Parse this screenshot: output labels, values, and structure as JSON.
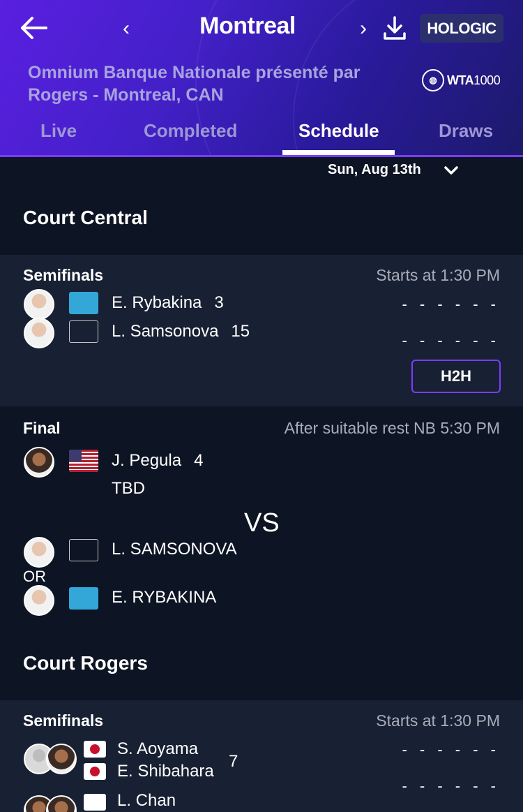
{
  "header": {
    "title": "Montreal",
    "sponsor": "HOLOGIC",
    "tournament_name": "Omnium Banque Nationale présenté par Rogers  - Montreal, CAN",
    "wta_label": "WTA",
    "wta_level": "1000",
    "tabs": [
      {
        "label": "Live"
      },
      {
        "label": "Completed"
      },
      {
        "label": "Schedule"
      },
      {
        "label": "Draws"
      }
    ],
    "active_tab": "Schedule",
    "accent_color": "#7b3cff"
  },
  "date_selector": {
    "value": "Sun, Aug 13th"
  },
  "courts": [
    {
      "name": "Court Central",
      "matches": [
        {
          "round": "Semifinals",
          "start": "Starts at 1:30 PM",
          "players": [
            {
              "name": "E. Rybakina",
              "seed": "3",
              "flag": "KAZ",
              "score": "- - - - - -"
            },
            {
              "name": "L. Samsonova",
              "seed": "15",
              "flag": "blank",
              "score": "- - - - - -"
            }
          ],
          "h2h_label": "H2H"
        },
        {
          "round": "Final",
          "start": "After suitable rest NB 5:30 PM",
          "player1": {
            "name": "J. Pegula",
            "seed": "4",
            "flag": "USA"
          },
          "tbd": "TBD",
          "vs": "VS",
          "or": "OR",
          "options": [
            {
              "name": "L. SAMSONOVA",
              "flag": "blank"
            },
            {
              "name": "E. RYBAKINA",
              "flag": "KAZ"
            }
          ]
        }
      ]
    },
    {
      "name": "Court Rogers",
      "matches": [
        {
          "round": "Semifinals",
          "start": "Starts at 1:30 PM",
          "team1": {
            "players": [
              "S. Aoyama",
              "E. Shibahara"
            ],
            "seed": "7",
            "flag": "JPN",
            "score": "- - - - - -"
          },
          "team2": {
            "players": [
              "L. Chan"
            ],
            "flag": "TPE",
            "score": "- - - - - -"
          }
        }
      ]
    }
  ]
}
